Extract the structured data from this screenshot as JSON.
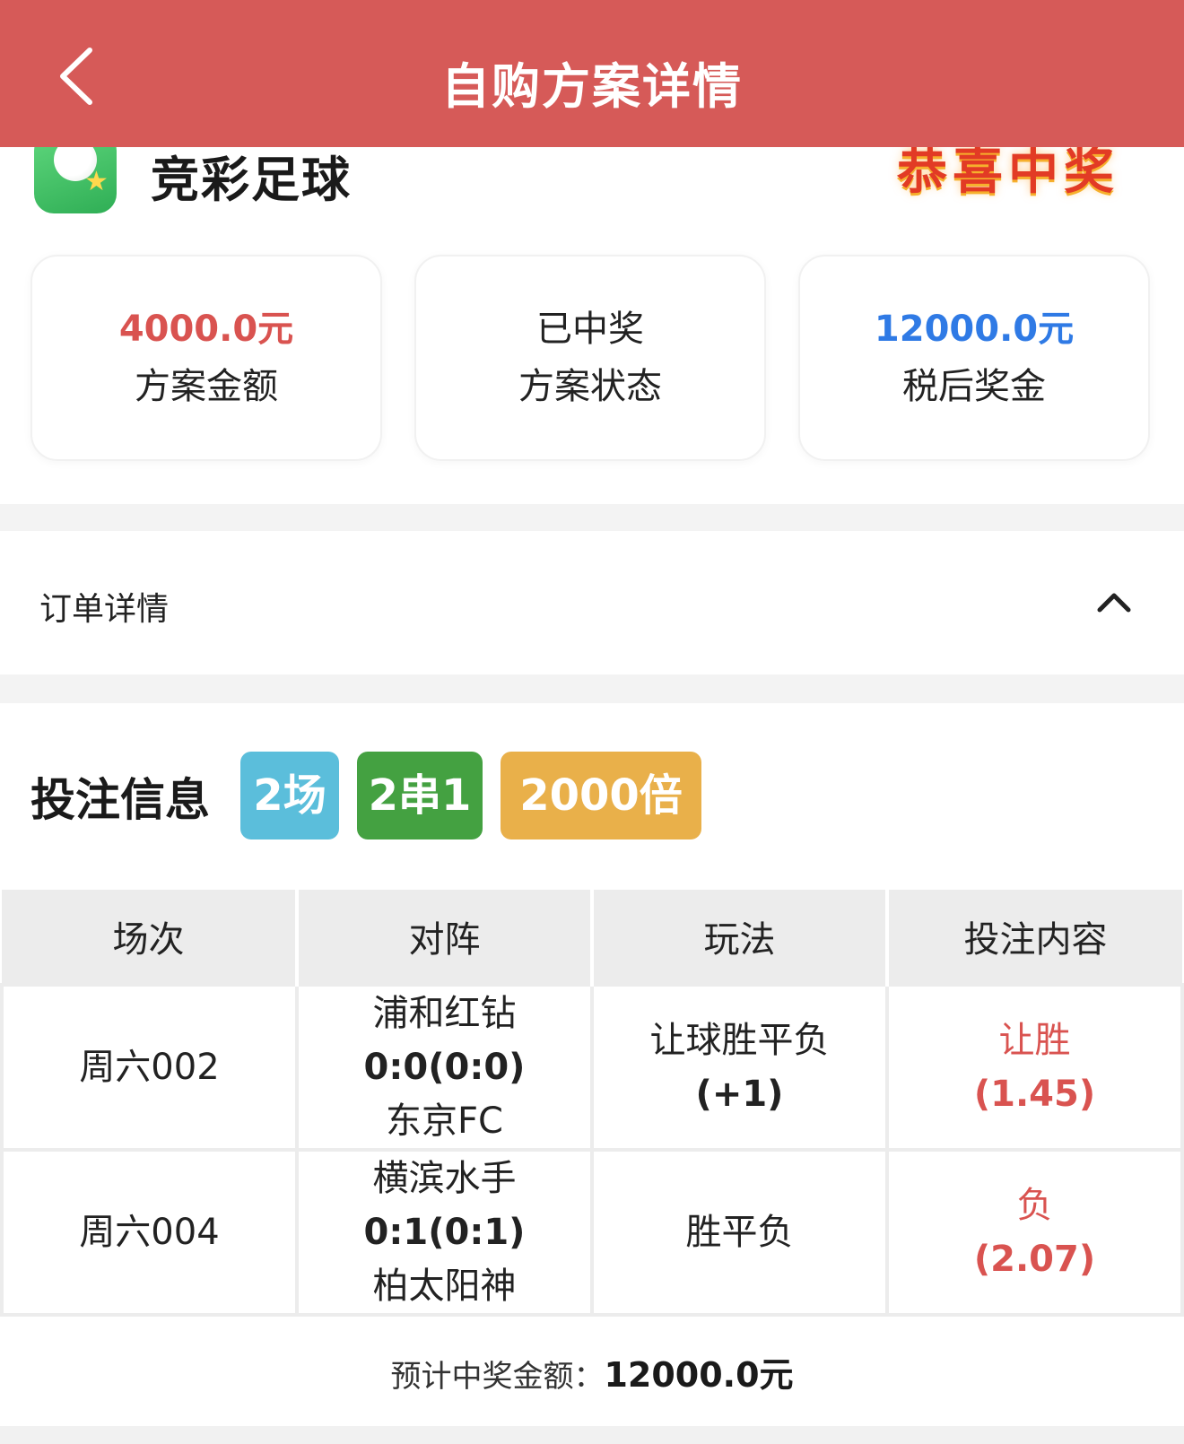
{
  "nav": {
    "title": "自购方案详情"
  },
  "lottery": {
    "name": "竞彩足球",
    "badge_text": "恭喜中奖"
  },
  "summary": [
    {
      "value": "4000.0元",
      "label": "方案金额",
      "color": "#d95350"
    },
    {
      "value": "已中奖",
      "label": "方案状态",
      "color": "#222222"
    },
    {
      "value": "12000.0元",
      "label": "税后奖金",
      "color": "#2f7ae5"
    }
  ],
  "order": {
    "label": "订单详情"
  },
  "bet": {
    "title": "投注信息",
    "tags": [
      "2场",
      "2串1",
      "2000倍"
    ],
    "tag_colors": [
      "#5bbedb",
      "#44a141",
      "#e9b04a"
    ]
  },
  "table": {
    "headers": [
      "场次",
      "对阵",
      "玩法",
      "投注内容"
    ],
    "rows": [
      {
        "match_no": "周六002",
        "home": "浦和红钻",
        "score": "0:0(0:0)",
        "away": "东京FC",
        "play_type": "让球胜平负",
        "handicap": "(+1)",
        "pick": "让胜",
        "odds": "(1.45)"
      },
      {
        "match_no": "周六004",
        "home": "横滨水手",
        "score": "0:1(0:1)",
        "away": "柏太阳神",
        "play_type": "胜平负",
        "handicap": "",
        "pick": "负",
        "odds": "(2.07)"
      }
    ]
  },
  "footer": {
    "label": "预计中奖金额：",
    "amount": "12000.0元"
  }
}
